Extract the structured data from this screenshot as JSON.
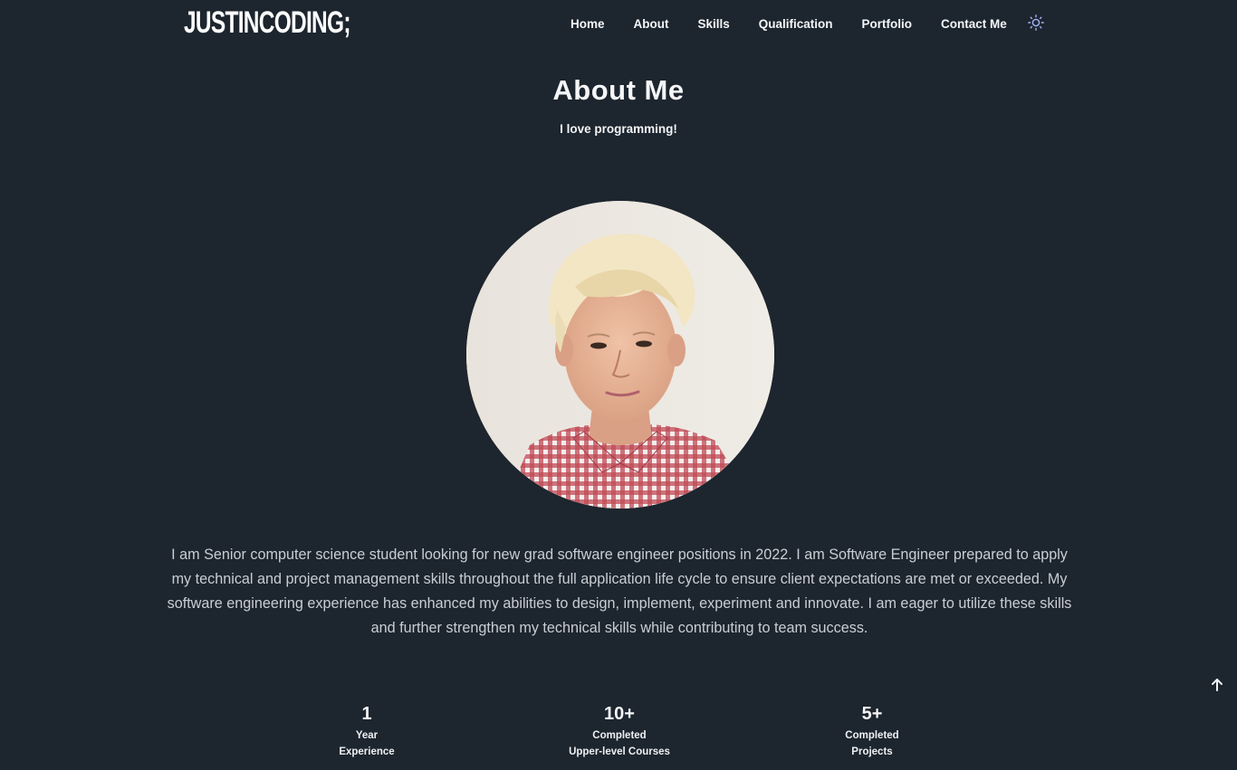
{
  "header": {
    "logo": "JUSTINCODING;",
    "nav": [
      {
        "label": "Home"
      },
      {
        "label": "About"
      },
      {
        "label": "Skills"
      },
      {
        "label": "Qualification"
      },
      {
        "label": "Portfolio"
      },
      {
        "label": "Contact Me"
      }
    ],
    "theme_icon": "sun-icon"
  },
  "about": {
    "title": "About Me",
    "subtitle": "I love programming!",
    "photo_icon": "profile-photo",
    "description": "I am Senior computer science student looking for new grad software engineer positions in 2022. I am Software Engineer prepared to apply my technical and project management skills throughout the full application life cycle to ensure client expectations are met or exceeded. My software engineering experience has enhanced my abilities to design, implement, experiment and innovate. I am eager to utilize these skills and further strengthen my technical skills while contributing to team success.",
    "stats": [
      {
        "number": "1",
        "line1": "Year",
        "line2": "Experience"
      },
      {
        "number": "10+",
        "line1": "Completed",
        "line2": "Upper-level Courses"
      },
      {
        "number": "5+",
        "line1": "Completed",
        "line2": "Projects"
      }
    ]
  },
  "scroll_up_icon": "arrow-up-icon",
  "colors": {
    "background": "#1d252e",
    "text": "#f2f4f6",
    "body_text": "#c9ced4",
    "accent": "#a5b4fc"
  }
}
